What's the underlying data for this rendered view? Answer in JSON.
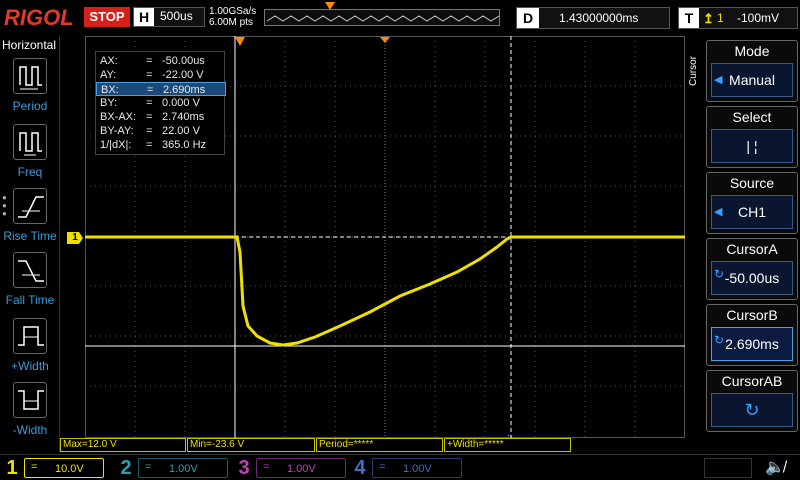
{
  "top": {
    "logo": "RIGOL",
    "run_state": "STOP",
    "horizontal_label": "H",
    "timebase": "500us",
    "sample_rate": "1.00GSa/s",
    "mem_depth": "6.00M pts",
    "delay_label": "D",
    "delay_value": "1.43000000ms",
    "trigger_label": "T",
    "trigger_edge": "↑",
    "trigger_channel": "1",
    "trigger_level": "-100mV"
  },
  "left_panel": {
    "title": "Horizontal",
    "items": [
      {
        "label": "Period",
        "icon": "period-icon"
      },
      {
        "label": "Freq",
        "icon": "freq-icon"
      },
      {
        "label": "Rise Time",
        "icon": "rise-time-icon"
      },
      {
        "label": "Fall Time",
        "icon": "fall-time-icon"
      },
      {
        "label": "+Width",
        "icon": "plus-width-icon"
      },
      {
        "label": "-Width",
        "icon": "minus-width-icon"
      }
    ]
  },
  "readout": {
    "rows": [
      {
        "key": "AX:",
        "eq": "=",
        "value": "-50.00us"
      },
      {
        "key": "AY:",
        "eq": "=",
        "value": "-22.00 V"
      },
      {
        "key": "BX:",
        "eq": "=",
        "value": "2.690ms"
      },
      {
        "key": "BY:",
        "eq": "=",
        "value": "0.000 V"
      },
      {
        "key": "BX-AX:",
        "eq": "=",
        "value": "2.740ms"
      },
      {
        "key": "BY-AY:",
        "eq": "=",
        "value": "22.00 V"
      },
      {
        "key": "1/|dX|:",
        "eq": "=",
        "value": "365.0 Hz"
      }
    ],
    "selected_row": 2
  },
  "right_panel": {
    "side_title": "Cursor",
    "mode_label": "Mode",
    "mode_value": "Manual",
    "select_label": "Select",
    "select_value": "|  ¦",
    "source_label": "Source",
    "source_value": "CH1",
    "cursor_a_label": "CursorA",
    "cursor_a_value": "-50.00us",
    "cursor_b_label": "CursorB",
    "cursor_b_value": "2.690ms",
    "cursor_ab_label": "CursorAB"
  },
  "markers": {
    "ch1_level": "1",
    "trigger_level_marker": "T",
    "trigger_pos": "T"
  },
  "measurements": {
    "max": "Max=12.0 V",
    "min": "Min=-23.6 V",
    "period": "Period=*****",
    "width": "+Width=*****"
  },
  "channels": [
    {
      "num": "1",
      "coupling": "=",
      "scale": "10.0V",
      "color": "#f0e000",
      "active": true
    },
    {
      "num": "2",
      "coupling": "=",
      "scale": "1.00V",
      "color": "#2aa0b0",
      "active": false
    },
    {
      "num": "3",
      "coupling": "=",
      "scale": "1.00V",
      "color": "#c040c0",
      "active": false
    },
    {
      "num": "4",
      "coupling": "=",
      "scale": "1.00V",
      "color": "#3a70d0",
      "active": false
    }
  ],
  "colors": {
    "ch1": "#f0e000",
    "accent_blue": "#3a9ad9",
    "stop_red": "#d8201a",
    "trigger_orange": "#ff8a00"
  }
}
